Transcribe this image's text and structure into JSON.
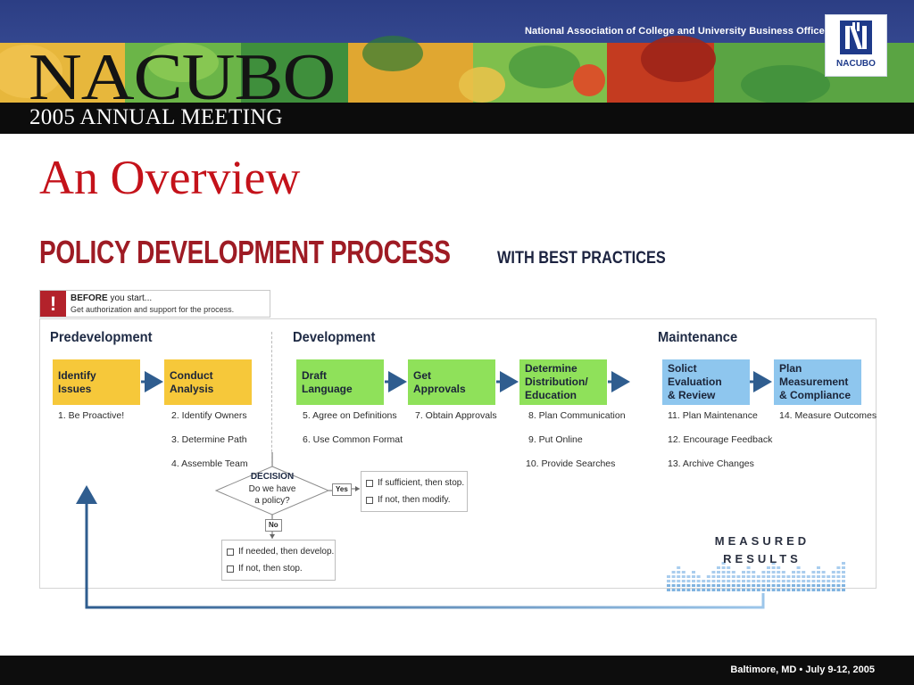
{
  "header": {
    "org_name": "National Association of College and University Business Officers",
    "title": "NACUBO",
    "meeting": "2005 ANNUAL MEETING",
    "logo_text": "NACUBO"
  },
  "slide": {
    "title": "An Overview",
    "heading": "POLICY DEVELOPMENT PROCESS",
    "subheading": "WITH BEST PRACTICES"
  },
  "before_note": {
    "mark": "!",
    "bold": "BEFORE",
    "rest": " you start...",
    "detail": "Get authorization and support for the process."
  },
  "phases": {
    "predevelopment": "Predevelopment",
    "development": "Development",
    "maintenance": "Maintenance"
  },
  "steps": [
    {
      "label": "Identify\nIssues",
      "phase": "predevelopment"
    },
    {
      "label": "Conduct\nAnalysis",
      "phase": "predevelopment"
    },
    {
      "label": "Draft\nLanguage",
      "phase": "development"
    },
    {
      "label": "Get\nApprovals",
      "phase": "development"
    },
    {
      "label": "Determine\nDistribution/\nEducation",
      "phase": "development"
    },
    {
      "label": "Solict\nEvaluation\n& Review",
      "phase": "maintenance"
    },
    {
      "label": "Plan\nMeasurement\n& Compliance",
      "phase": "maintenance"
    }
  ],
  "practices": [
    "1. Be Proactive!",
    "2. Identify Owners",
    "3. Determine Path",
    "4. Assemble Team",
    "5. Agree on Definitions",
    "6. Use Common Format",
    "7. Obtain Approvals",
    "8. Plan Communication",
    "9. Put Online",
    "10. Provide Searches",
    "11. Plan Maintenance",
    "12. Encourage Feedback",
    "13. Archive Changes",
    "14. Measure Outcomes"
  ],
  "decision": {
    "title": "DECISION",
    "question": "Do we have\na policy?",
    "yes": "Yes",
    "no": "No",
    "yes_options": [
      "If sufficient, then stop.",
      "If not, then modify."
    ],
    "no_options": [
      "If needed, then develop.",
      "If not, then stop."
    ]
  },
  "measured_results": "MEASURED\nRESULTS",
  "footer": {
    "text": "Baltimore, MD  •  July 9-12, 2005"
  },
  "colors": {
    "predevelopment": "#f6c83a",
    "development": "#8fe15a",
    "maintenance": "#8ec6ee",
    "arrow": "#2f5d8f",
    "title_red": "#c4121a",
    "heading_red": "#9e1b24"
  }
}
